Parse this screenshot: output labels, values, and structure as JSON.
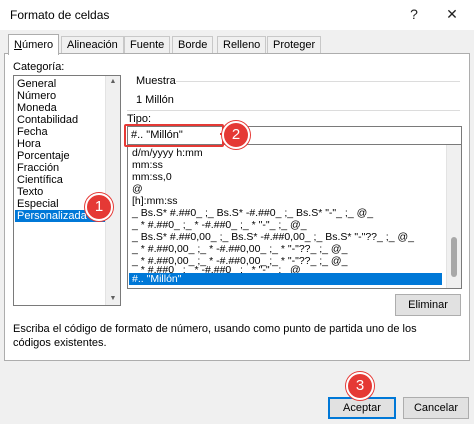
{
  "window": {
    "title": "Formato de celdas",
    "help_glyph": "?",
    "close_glyph": "✕"
  },
  "tabs": [
    {
      "label": "Número",
      "underline": "N",
      "rest": "úmero",
      "active": true
    },
    {
      "label": "Alineación",
      "active": false
    },
    {
      "label": "Fuente",
      "active": false
    },
    {
      "label": "Borde",
      "active": false
    },
    {
      "label": "Relleno",
      "active": false
    },
    {
      "label": "Proteger",
      "active": false
    }
  ],
  "category": {
    "label": "Categoría:",
    "items": [
      "General",
      "Número",
      "Moneda",
      "Contabilidad",
      "Fecha",
      "Hora",
      "Porcentaje",
      "Fracción",
      "Científica",
      "Texto",
      "Especial",
      "Personalizada"
    ],
    "selected": "Personalizada"
  },
  "muestra": {
    "label": "Muestra",
    "value": "1 Millón"
  },
  "tipo": {
    "label": "Tipo:",
    "value": "#.. \"Millón\"",
    "formats": [
      "d/m/yyyy h:mm",
      "mm:ss",
      "mm:ss,0",
      "@",
      "[h]:mm:ss",
      "_ Bs.S* #.##0_ ;_ Bs.S* -#.##0_ ;_ Bs.S* \"-\"_ ;_ @_",
      "_ * #.##0_ ;_ * -#.##0_ ;_ * \"-\"_ ;_ @_",
      "_ Bs.S* #.##0,00_ ;_ Bs.S* -#.##0,00_ ;_ Bs.S* \"-\"??_ ;_ @_",
      "_ * #.##0,00_ ;_ * -#.##0,00_ ;_ * \"-\"??_ ;_ @_",
      "_ * #.##0,00_ ;_ * -#.##0,00_ ;_ * \"-\"??_ ;_ @_",
      "_ * #.##0_ ;_ * -#.##0_ ;_ * \"-\"_ ;_ @_",
      "#.. \"Millón\""
    ],
    "selected": "#.. \"Millón\""
  },
  "buttons": {
    "eliminar": "Eliminar",
    "aceptar": "Aceptar",
    "cancelar": "Cancelar"
  },
  "description": "Escriba el código de formato de número, usando como punto de partida uno de los códigos existentes.",
  "annotations": [
    "1",
    "2",
    "3"
  ],
  "colors": {
    "selection": "#0078d7",
    "annotation": "#e53935"
  }
}
